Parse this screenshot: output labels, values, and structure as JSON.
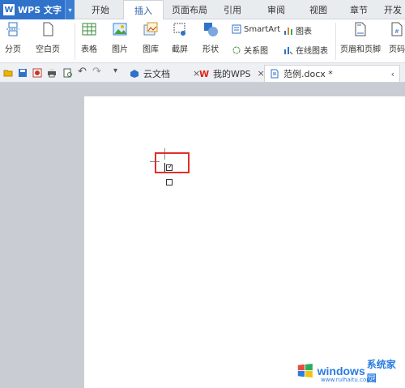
{
  "app": {
    "name": "WPS 文字",
    "logo_letter": "W"
  },
  "menu_tabs": [
    "开始",
    "插入",
    "页面布局",
    "引用",
    "审阅",
    "视图",
    "章节",
    "开发"
  ],
  "active_menu_tab": "插入",
  "ribbon": {
    "page_break": "分页",
    "blank_page": "空白页",
    "table": "表格",
    "picture": "图片",
    "gallery": "图库",
    "screenshot": "截屏",
    "shape": "形状",
    "smartart": "SmartArt",
    "chart": "图表",
    "relation_chart": "关系图",
    "online_chart": "在线图表",
    "header_footer": "页眉和页脚",
    "page_number": "页码"
  },
  "doc_tabs": [
    {
      "label": "云文档"
    },
    {
      "label": "我的WPS"
    },
    {
      "label": "范例.docx *"
    }
  ],
  "document": {
    "checkbox_1": "☑",
    "checkbox_2": "☐"
  },
  "watermark": {
    "text": "windows",
    "sub": "系统家园",
    "url": "www.ruihaitu.com"
  },
  "colors": {
    "accent": "#2f72c9",
    "highlight": "#e0302a",
    "canvas": "#c9cdd3"
  }
}
